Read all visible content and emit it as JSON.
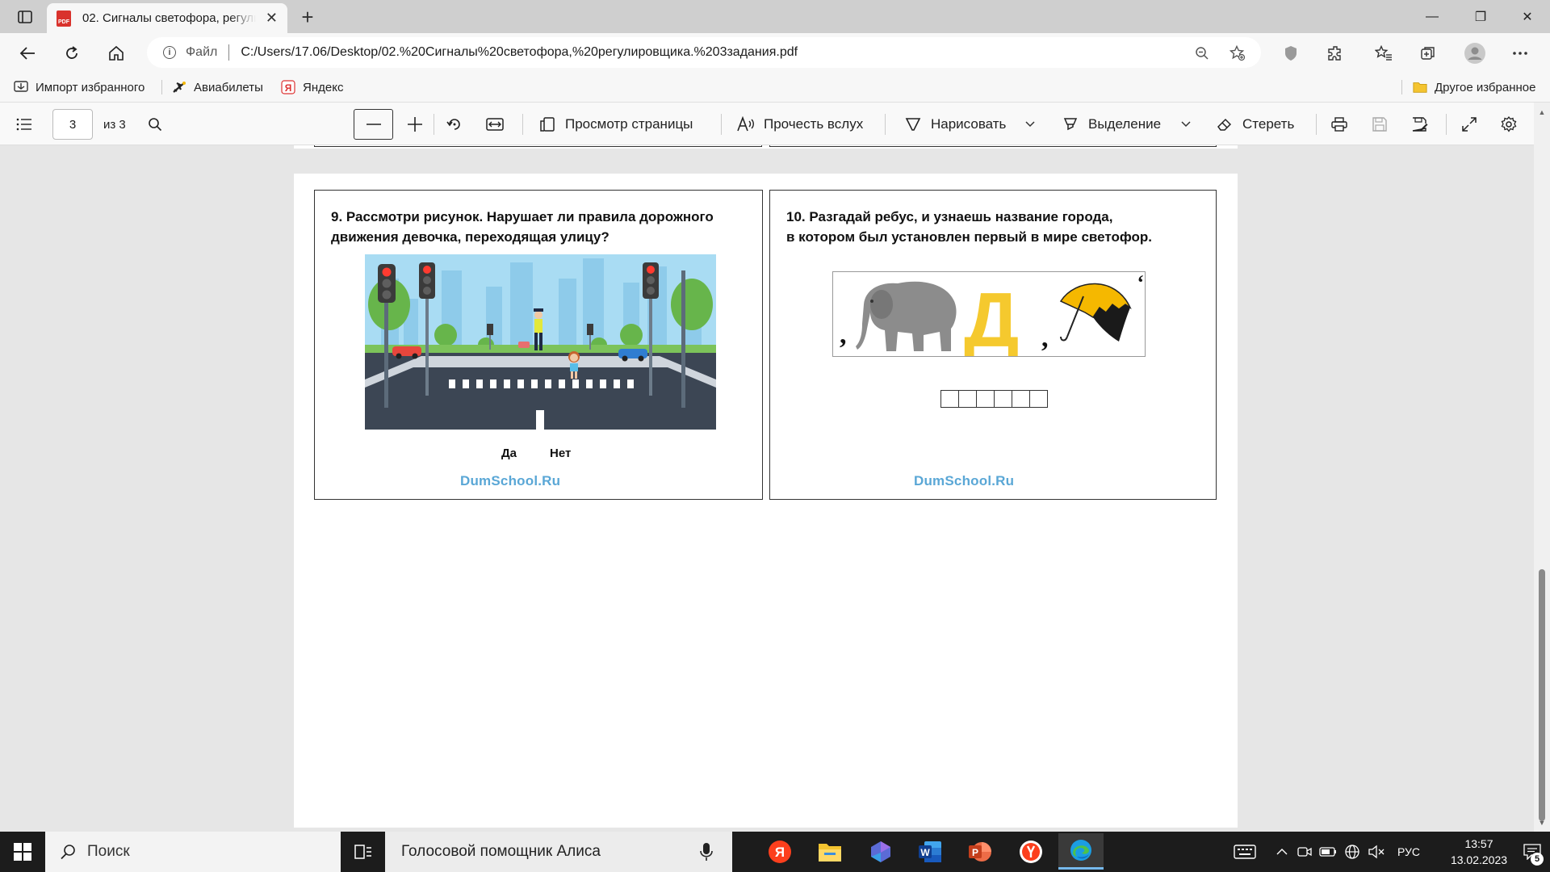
{
  "browser": {
    "tab": {
      "title": "02. Сигналы светофора, регулировщика. 3 задания.pdf",
      "pdf_badge": "PDF",
      "close": "✕"
    },
    "new_tab": "+",
    "window": {
      "minimize": "—",
      "maximize": "❐",
      "close": "✕"
    },
    "address": {
      "file_label": "Файл",
      "url": "C:/Users/17.06/Desktop/02.%20Сигналы%20светофора,%20регулировщика.%203задания.pdf"
    },
    "favorites": {
      "items": [
        {
          "label": "Импорт избранного"
        },
        {
          "label": "Авиабилеты"
        },
        {
          "label": "Яндекс"
        }
      ],
      "other": "Другое избранное"
    }
  },
  "pdf_toolbar": {
    "page_current": "3",
    "page_total": "из 3",
    "page_view": "Просмотр страницы",
    "read_aloud": "Прочесть вслух",
    "draw": "Нарисовать",
    "highlight": "Выделение",
    "erase": "Стереть"
  },
  "document": {
    "task9": {
      "question": "9. Рассмотри рисунок. Нарушает ли правила дорожного\nдвижения девочка, переходящая улицу?",
      "answer_yes": "Да",
      "answer_no": "Нет",
      "watermark": "DumSchool.Ru"
    },
    "task10": {
      "question": "10. Разгадай ребус, и узнаешь название города,\nв котором был установлен первый в мире светофор.",
      "rebus_letter": "Д",
      "answer_cells": 6,
      "watermark": "DumSchool.Ru"
    }
  },
  "taskbar": {
    "search_placeholder": "Поиск",
    "alice": "Голосовой помощник Алиса",
    "lang": "РУС",
    "time": "13:57",
    "date": "13.02.2023",
    "notifications": "5"
  },
  "colors": {
    "accent": "#0067c0",
    "watermark": "#5aa7d6",
    "taskbar": "#1c1c1c"
  }
}
